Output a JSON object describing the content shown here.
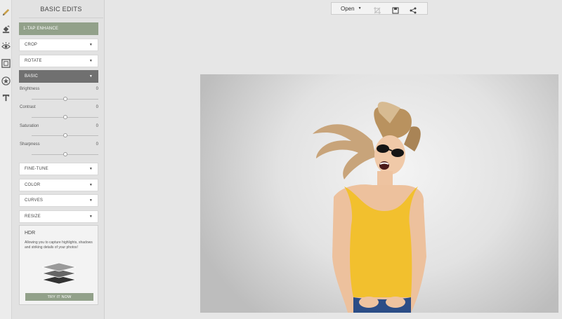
{
  "panel": {
    "title": "BASIC EDITS",
    "enhance_label": "1-TAP ENHANCE",
    "sections_top": [
      {
        "label": "CROP"
      },
      {
        "label": "ROTATE"
      }
    ],
    "basic_label": "BASIC",
    "sliders": [
      {
        "label": "Brightness",
        "value": "0",
        "level": 0.5
      },
      {
        "label": "Contrast",
        "value": "0",
        "level": 0.5
      },
      {
        "label": "Saturation",
        "value": "0",
        "level": 0.5
      },
      {
        "label": "Sharpness",
        "value": "0",
        "level": 0.5
      }
    ],
    "sections_bottom": [
      {
        "label": "FINE-TUNE"
      },
      {
        "label": "COLOR"
      },
      {
        "label": "CURVES"
      },
      {
        "label": "RESIZE"
      }
    ],
    "caret": "▼"
  },
  "hdr": {
    "title": "HDR",
    "description": "Allowing you to capture highlights, shadows and striking details of your photos!",
    "button_label": "TRY IT NOW"
  },
  "toolbar": {
    "open_label": "Open",
    "caret": "▼"
  },
  "colors": {
    "accent": "#92a18a",
    "active_section": "#707070",
    "brush": "#c9a04a"
  },
  "icons": [
    "pencil-icon",
    "paint-bucket-icon",
    "eye-icon",
    "frame-icon",
    "star-icon",
    "text-icon",
    "crop-icon",
    "save-icon",
    "share-icon"
  ]
}
